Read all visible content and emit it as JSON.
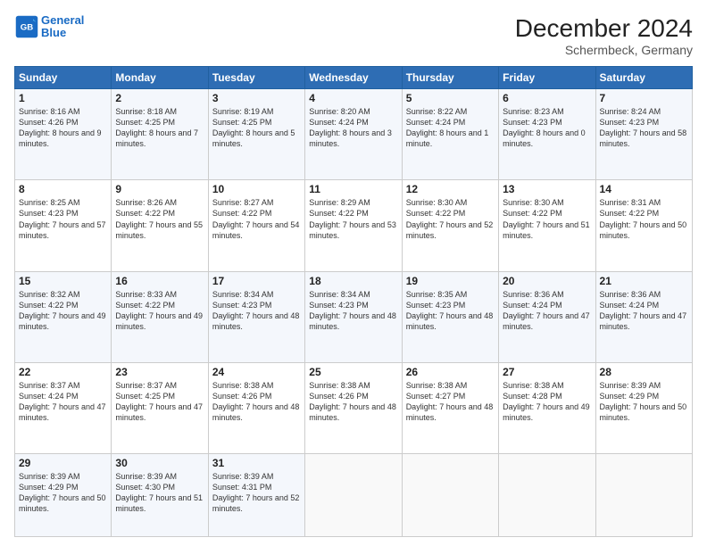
{
  "header": {
    "logo_line1": "General",
    "logo_line2": "Blue",
    "month_year": "December 2024",
    "location": "Schermbeck, Germany"
  },
  "days_of_week": [
    "Sunday",
    "Monday",
    "Tuesday",
    "Wednesday",
    "Thursday",
    "Friday",
    "Saturday"
  ],
  "weeks": [
    [
      {
        "day": "1",
        "sunrise": "Sunrise: 8:16 AM",
        "sunset": "Sunset: 4:26 PM",
        "daylight": "Daylight: 8 hours and 9 minutes."
      },
      {
        "day": "2",
        "sunrise": "Sunrise: 8:18 AM",
        "sunset": "Sunset: 4:25 PM",
        "daylight": "Daylight: 8 hours and 7 minutes."
      },
      {
        "day": "3",
        "sunrise": "Sunrise: 8:19 AM",
        "sunset": "Sunset: 4:25 PM",
        "daylight": "Daylight: 8 hours and 5 minutes."
      },
      {
        "day": "4",
        "sunrise": "Sunrise: 8:20 AM",
        "sunset": "Sunset: 4:24 PM",
        "daylight": "Daylight: 8 hours and 3 minutes."
      },
      {
        "day": "5",
        "sunrise": "Sunrise: 8:22 AM",
        "sunset": "Sunset: 4:24 PM",
        "daylight": "Daylight: 8 hours and 1 minute."
      },
      {
        "day": "6",
        "sunrise": "Sunrise: 8:23 AM",
        "sunset": "Sunset: 4:23 PM",
        "daylight": "Daylight: 8 hours and 0 minutes."
      },
      {
        "day": "7",
        "sunrise": "Sunrise: 8:24 AM",
        "sunset": "Sunset: 4:23 PM",
        "daylight": "Daylight: 7 hours and 58 minutes."
      }
    ],
    [
      {
        "day": "8",
        "sunrise": "Sunrise: 8:25 AM",
        "sunset": "Sunset: 4:23 PM",
        "daylight": "Daylight: 7 hours and 57 minutes."
      },
      {
        "day": "9",
        "sunrise": "Sunrise: 8:26 AM",
        "sunset": "Sunset: 4:22 PM",
        "daylight": "Daylight: 7 hours and 55 minutes."
      },
      {
        "day": "10",
        "sunrise": "Sunrise: 8:27 AM",
        "sunset": "Sunset: 4:22 PM",
        "daylight": "Daylight: 7 hours and 54 minutes."
      },
      {
        "day": "11",
        "sunrise": "Sunrise: 8:29 AM",
        "sunset": "Sunset: 4:22 PM",
        "daylight": "Daylight: 7 hours and 53 minutes."
      },
      {
        "day": "12",
        "sunrise": "Sunrise: 8:30 AM",
        "sunset": "Sunset: 4:22 PM",
        "daylight": "Daylight: 7 hours and 52 minutes."
      },
      {
        "day": "13",
        "sunrise": "Sunrise: 8:30 AM",
        "sunset": "Sunset: 4:22 PM",
        "daylight": "Daylight: 7 hours and 51 minutes."
      },
      {
        "day": "14",
        "sunrise": "Sunrise: 8:31 AM",
        "sunset": "Sunset: 4:22 PM",
        "daylight": "Daylight: 7 hours and 50 minutes."
      }
    ],
    [
      {
        "day": "15",
        "sunrise": "Sunrise: 8:32 AM",
        "sunset": "Sunset: 4:22 PM",
        "daylight": "Daylight: 7 hours and 49 minutes."
      },
      {
        "day": "16",
        "sunrise": "Sunrise: 8:33 AM",
        "sunset": "Sunset: 4:22 PM",
        "daylight": "Daylight: 7 hours and 49 minutes."
      },
      {
        "day": "17",
        "sunrise": "Sunrise: 8:34 AM",
        "sunset": "Sunset: 4:23 PM",
        "daylight": "Daylight: 7 hours and 48 minutes."
      },
      {
        "day": "18",
        "sunrise": "Sunrise: 8:34 AM",
        "sunset": "Sunset: 4:23 PM",
        "daylight": "Daylight: 7 hours and 48 minutes."
      },
      {
        "day": "19",
        "sunrise": "Sunrise: 8:35 AM",
        "sunset": "Sunset: 4:23 PM",
        "daylight": "Daylight: 7 hours and 48 minutes."
      },
      {
        "day": "20",
        "sunrise": "Sunrise: 8:36 AM",
        "sunset": "Sunset: 4:24 PM",
        "daylight": "Daylight: 7 hours and 47 minutes."
      },
      {
        "day": "21",
        "sunrise": "Sunrise: 8:36 AM",
        "sunset": "Sunset: 4:24 PM",
        "daylight": "Daylight: 7 hours and 47 minutes."
      }
    ],
    [
      {
        "day": "22",
        "sunrise": "Sunrise: 8:37 AM",
        "sunset": "Sunset: 4:24 PM",
        "daylight": "Daylight: 7 hours and 47 minutes."
      },
      {
        "day": "23",
        "sunrise": "Sunrise: 8:37 AM",
        "sunset": "Sunset: 4:25 PM",
        "daylight": "Daylight: 7 hours and 47 minutes."
      },
      {
        "day": "24",
        "sunrise": "Sunrise: 8:38 AM",
        "sunset": "Sunset: 4:26 PM",
        "daylight": "Daylight: 7 hours and 48 minutes."
      },
      {
        "day": "25",
        "sunrise": "Sunrise: 8:38 AM",
        "sunset": "Sunset: 4:26 PM",
        "daylight": "Daylight: 7 hours and 48 minutes."
      },
      {
        "day": "26",
        "sunrise": "Sunrise: 8:38 AM",
        "sunset": "Sunset: 4:27 PM",
        "daylight": "Daylight: 7 hours and 48 minutes."
      },
      {
        "day": "27",
        "sunrise": "Sunrise: 8:38 AM",
        "sunset": "Sunset: 4:28 PM",
        "daylight": "Daylight: 7 hours and 49 minutes."
      },
      {
        "day": "28",
        "sunrise": "Sunrise: 8:39 AM",
        "sunset": "Sunset: 4:29 PM",
        "daylight": "Daylight: 7 hours and 50 minutes."
      }
    ],
    [
      {
        "day": "29",
        "sunrise": "Sunrise: 8:39 AM",
        "sunset": "Sunset: 4:29 PM",
        "daylight": "Daylight: 7 hours and 50 minutes."
      },
      {
        "day": "30",
        "sunrise": "Sunrise: 8:39 AM",
        "sunset": "Sunset: 4:30 PM",
        "daylight": "Daylight: 7 hours and 51 minutes."
      },
      {
        "day": "31",
        "sunrise": "Sunrise: 8:39 AM",
        "sunset": "Sunset: 4:31 PM",
        "daylight": "Daylight: 7 hours and 52 minutes."
      },
      null,
      null,
      null,
      null
    ]
  ]
}
